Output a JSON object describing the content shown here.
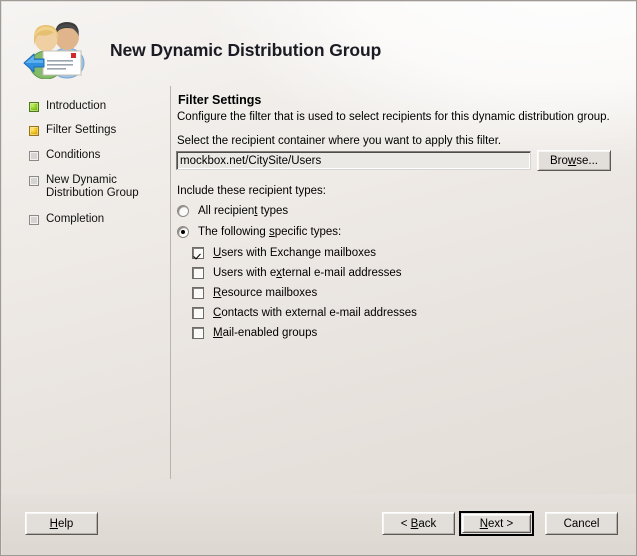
{
  "window": {
    "title": "New Dynamic Distribution Group",
    "icon": "distribution-group-icon"
  },
  "sidebar": {
    "items": [
      {
        "label": "Introduction",
        "state": "done"
      },
      {
        "label": "Filter Settings",
        "state": "current"
      },
      {
        "label": "Conditions",
        "state": "pending"
      },
      {
        "label": "New Dynamic\nDistribution Group",
        "state": "pending"
      },
      {
        "label": "Completion",
        "state": "pending"
      }
    ]
  },
  "content": {
    "section_title": "Filter Settings",
    "section_description": "Configure the filter that is used to select recipients for this dynamic distribution group.",
    "field_label": "Select the recipient container where you want to apply this filter.",
    "container_value": "mockbox.net/CitySite/Users",
    "browse_button": "Browse...",
    "browse_mnemonic": "w",
    "include_label": "Include these recipient types:",
    "radios": [
      {
        "label": "All recipient types",
        "mnemonic": "t",
        "selected": false
      },
      {
        "label": "The following specific types:",
        "mnemonic": "s",
        "selected": true
      }
    ],
    "checkboxes": [
      {
        "label": "Users with Exchange mailboxes",
        "mnemonic": "U",
        "checked": true
      },
      {
        "label": "Users with external e-mail addresses",
        "mnemonic": "x",
        "checked": false
      },
      {
        "label": "Resource mailboxes",
        "mnemonic": "R",
        "checked": false
      },
      {
        "label": "Contacts with external e-mail addresses",
        "mnemonic": "C",
        "checked": false
      },
      {
        "label": "Mail-enabled groups",
        "mnemonic": "M",
        "checked": false
      }
    ]
  },
  "buttons": {
    "help": "Help",
    "help_mnemonic": "H",
    "back": "< Back",
    "back_mnemonic": "B",
    "next": "Next >",
    "next_mnemonic": "N",
    "cancel": "Cancel"
  },
  "colors": {
    "step_done": "#8ed11e",
    "step_current": "#f2c211",
    "step_pending": "#d6d3d0",
    "window_bg": "#e4dfda",
    "divider": "#b9b4af"
  }
}
